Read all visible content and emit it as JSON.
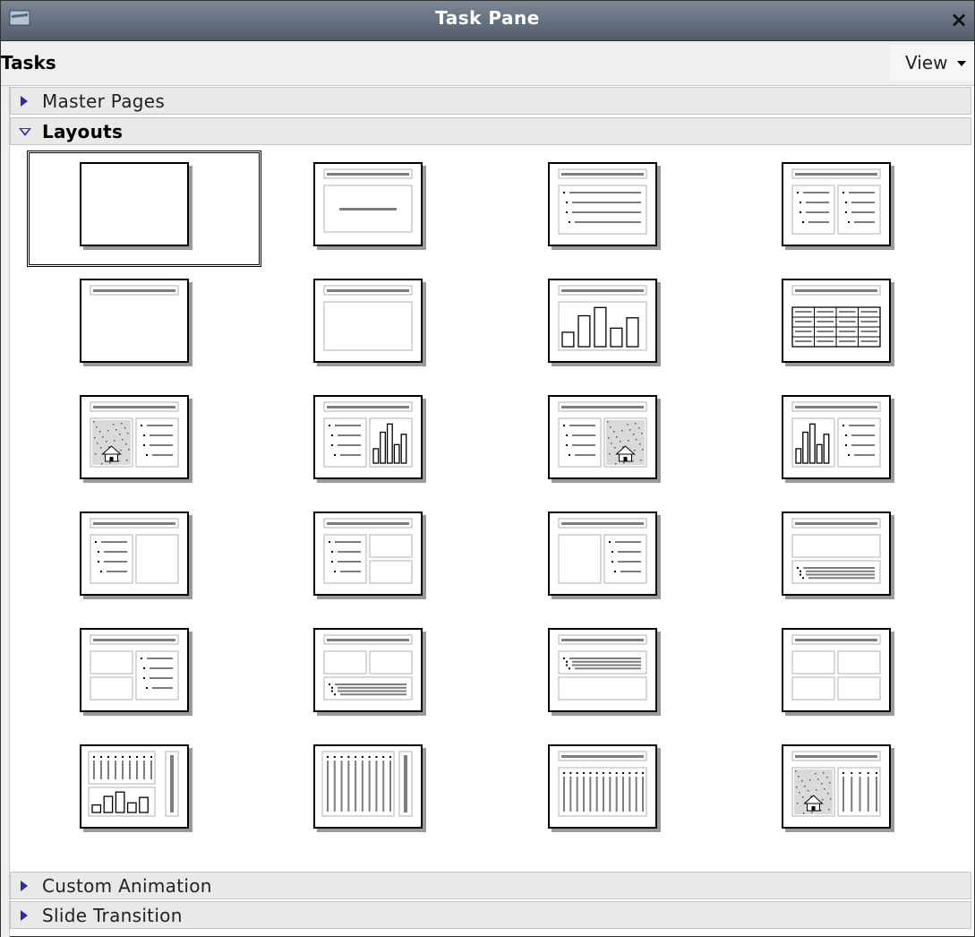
{
  "window": {
    "title": "Task Pane",
    "close_label": "×"
  },
  "tasks_bar": {
    "label": "Tasks",
    "view_label": "View"
  },
  "sections": {
    "master_pages": "Master Pages",
    "layouts": "Layouts",
    "custom_animation": "Custom Animation",
    "slide_transition": "Slide Transition"
  },
  "layouts": [
    {
      "kind": "blank",
      "selected": true
    },
    {
      "kind": "title-slide"
    },
    {
      "kind": "title-content"
    },
    {
      "kind": "title-2-content"
    },
    {
      "kind": "title-only"
    },
    {
      "kind": "centered-text"
    },
    {
      "kind": "title-chart"
    },
    {
      "kind": "title-table"
    },
    {
      "kind": "title-clipart-text"
    },
    {
      "kind": "title-text-chart"
    },
    {
      "kind": "title-text-clipart"
    },
    {
      "kind": "title-chart-text"
    },
    {
      "kind": "title-text-content"
    },
    {
      "kind": "title-text-2-content"
    },
    {
      "kind": "title-content-text"
    },
    {
      "kind": "title-content-over-text"
    },
    {
      "kind": "title-2-content-text"
    },
    {
      "kind": "title-2-content-over-text"
    },
    {
      "kind": "title-text-over-content"
    },
    {
      "kind": "title-4-content"
    },
    {
      "kind": "vertical-text-chart"
    },
    {
      "kind": "vertical-title-text"
    },
    {
      "kind": "title-vertical-text"
    },
    {
      "kind": "title-clipart-vertical-text"
    }
  ]
}
